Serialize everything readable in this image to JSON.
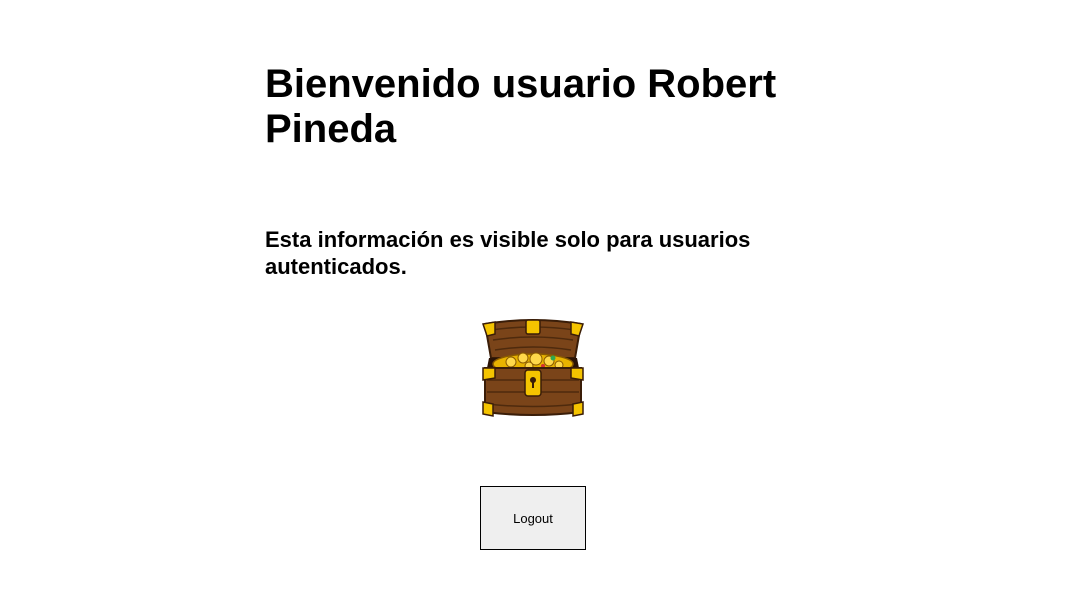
{
  "header": {
    "welcome_text": "Bienvenido usuario Robert Pineda"
  },
  "main": {
    "info_text": "Esta información es visible solo para usuarios autenticados.",
    "image_icon": "treasure-chest-icon",
    "logout_label": "Logout"
  },
  "colors": {
    "chest_wood": "#7a4419",
    "chest_gold": "#f5c400",
    "button_bg": "#efefef"
  }
}
